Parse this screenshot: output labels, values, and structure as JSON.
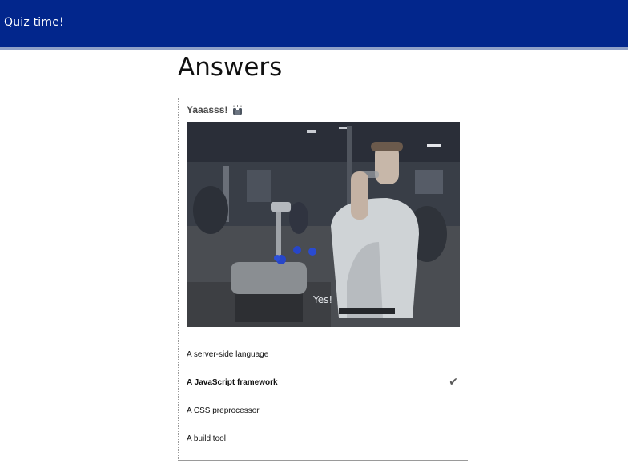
{
  "appbar": {
    "title": "Quiz time!"
  },
  "page": {
    "title": "Answers"
  },
  "result": {
    "heading": "Yaaasss!",
    "emoji_icon": "raising-hands-icon",
    "gif_caption": "Yes!"
  },
  "options": [
    {
      "label": "A server-side language",
      "correct": false
    },
    {
      "label": "A JavaScript framework",
      "correct": true
    },
    {
      "label": "A CSS preprocessor",
      "correct": false
    },
    {
      "label": "A build tool",
      "correct": false
    }
  ],
  "colors": {
    "appbar_bg": "#02268c",
    "appbar_border": "#8fa0c7",
    "check": "#5a5a5a"
  }
}
